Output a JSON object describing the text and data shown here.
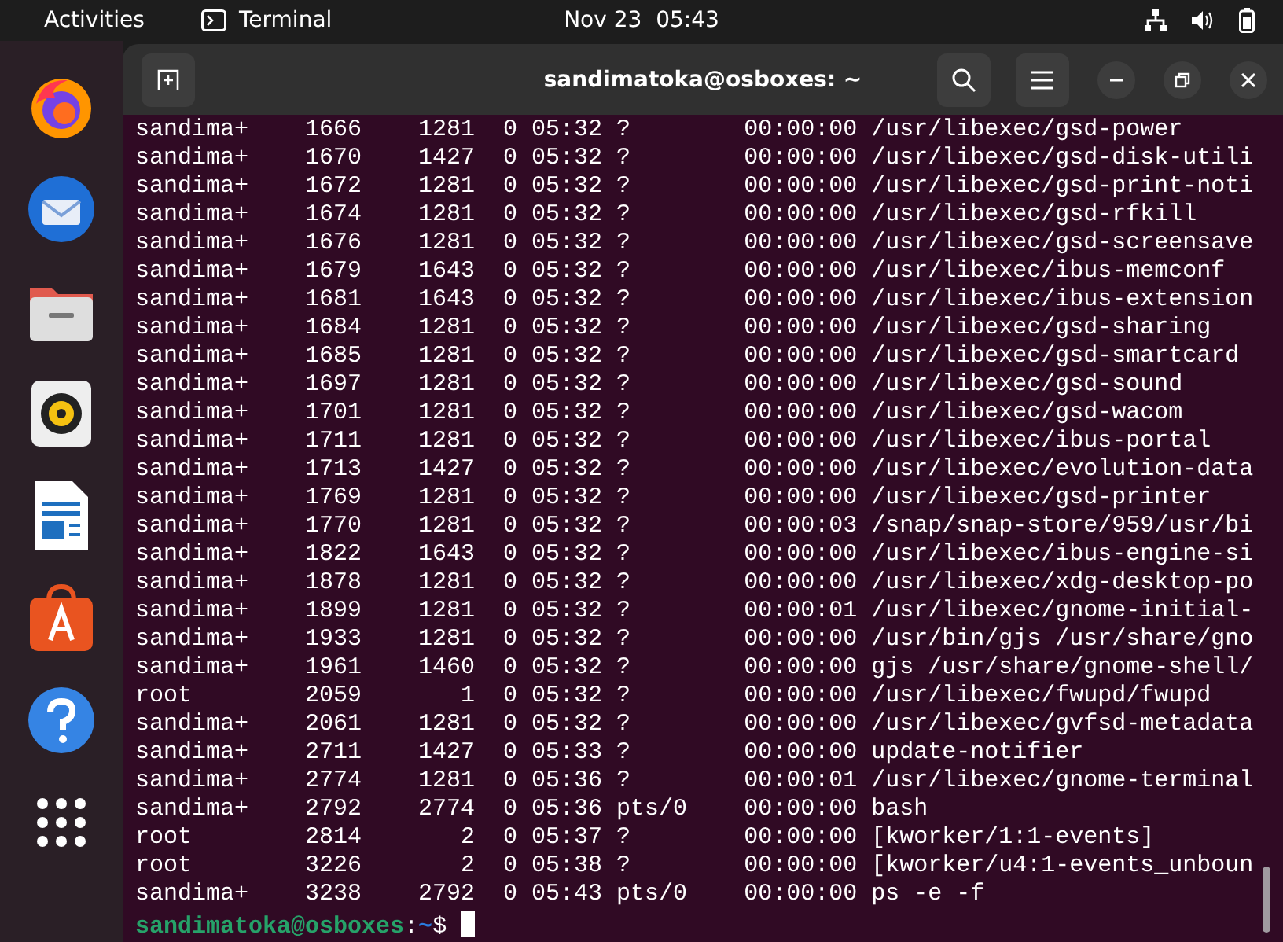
{
  "top_bar": {
    "activities": "Activities",
    "app_name": "Terminal",
    "clock": "Nov 23  05:43"
  },
  "window": {
    "title": "sandimatoka@osboxes: ~"
  },
  "terminal": {
    "lines": [
      "sandima+    1666    1281  0 05:32 ?        00:00:00 /usr/libexec/gsd-power",
      "sandima+    1670    1427  0 05:32 ?        00:00:00 /usr/libexec/gsd-disk-utili",
      "sandima+    1672    1281  0 05:32 ?        00:00:00 /usr/libexec/gsd-print-noti",
      "sandima+    1674    1281  0 05:32 ?        00:00:00 /usr/libexec/gsd-rfkill",
      "sandima+    1676    1281  0 05:32 ?        00:00:00 /usr/libexec/gsd-screensave",
      "sandima+    1679    1643  0 05:32 ?        00:00:00 /usr/libexec/ibus-memconf",
      "sandima+    1681    1643  0 05:32 ?        00:00:00 /usr/libexec/ibus-extension",
      "sandima+    1684    1281  0 05:32 ?        00:00:00 /usr/libexec/gsd-sharing",
      "sandima+    1685    1281  0 05:32 ?        00:00:00 /usr/libexec/gsd-smartcard",
      "sandima+    1697    1281  0 05:32 ?        00:00:00 /usr/libexec/gsd-sound",
      "sandima+    1701    1281  0 05:32 ?        00:00:00 /usr/libexec/gsd-wacom",
      "sandima+    1711    1281  0 05:32 ?        00:00:00 /usr/libexec/ibus-portal",
      "sandima+    1713    1427  0 05:32 ?        00:00:00 /usr/libexec/evolution-data",
      "sandima+    1769    1281  0 05:32 ?        00:00:00 /usr/libexec/gsd-printer",
      "sandima+    1770    1281  0 05:32 ?        00:00:03 /snap/snap-store/959/usr/bi",
      "sandima+    1822    1643  0 05:32 ?        00:00:00 /usr/libexec/ibus-engine-si",
      "sandima+    1878    1281  0 05:32 ?        00:00:00 /usr/libexec/xdg-desktop-po",
      "sandima+    1899    1281  0 05:32 ?        00:00:01 /usr/libexec/gnome-initial-",
      "sandima+    1933    1281  0 05:32 ?        00:00:00 /usr/bin/gjs /usr/share/gno",
      "sandima+    1961    1460  0 05:32 ?        00:00:00 gjs /usr/share/gnome-shell/",
      "root        2059       1  0 05:32 ?        00:00:00 /usr/libexec/fwupd/fwupd",
      "sandima+    2061    1281  0 05:32 ?        00:00:00 /usr/libexec/gvfsd-metadata",
      "sandima+    2711    1427  0 05:33 ?        00:00:00 update-notifier",
      "sandima+    2774    1281  0 05:36 ?        00:00:01 /usr/libexec/gnome-terminal",
      "sandima+    2792    2774  0 05:36 pts/0    00:00:00 bash",
      "root        2814       2  0 05:37 ?        00:00:00 [kworker/1:1-events]",
      "root        3226       2  0 05:38 ?        00:00:00 [kworker/u4:1-events_unboun",
      "sandima+    3238    2792  0 05:43 pts/0    00:00:00 ps -e -f"
    ],
    "prompt": {
      "user_host": "sandimatoka@osboxes",
      "separator": ":",
      "path": "~",
      "symbol": "$"
    }
  },
  "dock": {
    "apps": [
      {
        "kind": "firefox"
      },
      {
        "kind": "thunderbird"
      },
      {
        "kind": "files"
      },
      {
        "kind": "rhythmbox"
      },
      {
        "kind": "writer"
      },
      {
        "kind": "appcenter"
      },
      {
        "kind": "help"
      },
      {
        "kind": "grid"
      }
    ]
  }
}
